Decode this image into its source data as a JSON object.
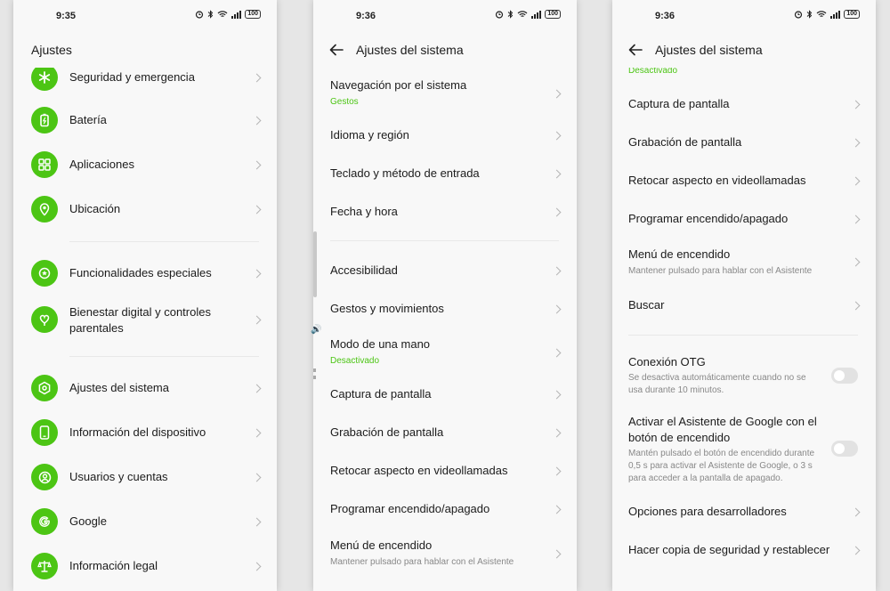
{
  "colors": {
    "accent": "#4cc514",
    "background": "#f8f8f8",
    "text": "#1b1b1b",
    "subtext": "#888888"
  },
  "screen1": {
    "time": "9:35",
    "battery": "100",
    "title": "Ajustes",
    "items": [
      {
        "label": "Seguridad y emergencia",
        "icon": "asterisk-icon"
      },
      {
        "label": "Batería",
        "icon": "battery-icon"
      },
      {
        "label": "Aplicaciones",
        "icon": "apps-grid-icon"
      },
      {
        "label": "Ubicación",
        "icon": "location-pin-icon"
      },
      {
        "label": "Funcionalidades especiales",
        "icon": "star-badge-icon"
      },
      {
        "label": "Bienestar digital y controles parentales",
        "icon": "heart-hand-icon"
      },
      {
        "label": "Ajustes del sistema",
        "icon": "gear-hexagon-icon"
      },
      {
        "label": "Información del dispositivo",
        "icon": "phone-device-icon"
      },
      {
        "label": "Usuarios y cuentas",
        "icon": "user-icon"
      },
      {
        "label": "Google",
        "icon": "google-icon"
      },
      {
        "label": "Información legal",
        "icon": "scales-icon"
      }
    ]
  },
  "screen2": {
    "time": "9:36",
    "battery": "100",
    "title": "Ajustes del sistema",
    "items": [
      {
        "label": "Navegación por el sistema",
        "sub": "Gestos"
      },
      {
        "label": "Idioma y región"
      },
      {
        "label": "Teclado y método de entrada"
      },
      {
        "label": "Fecha y hora"
      },
      {
        "label": "Accesibilidad"
      },
      {
        "label": "Gestos y movimientos"
      },
      {
        "label": "Modo de una mano",
        "sub": "Desactivado"
      },
      {
        "label": "Captura de pantalla"
      },
      {
        "label": "Grabación de pantalla"
      },
      {
        "label": "Retocar aspecto en videollamadas"
      },
      {
        "label": "Programar encendido/apagado"
      },
      {
        "label": "Menú de encendido",
        "sub": "Mantener pulsado para hablar con el Asistente"
      }
    ]
  },
  "screen3": {
    "time": "9:36",
    "battery": "100",
    "title": "Ajustes del sistema",
    "top_sub": "Desactivado",
    "items": [
      {
        "label": "Captura de pantalla"
      },
      {
        "label": "Grabación de pantalla"
      },
      {
        "label": "Retocar aspecto en videollamadas"
      },
      {
        "label": "Programar encendido/apagado"
      },
      {
        "label": "Menú de encendido",
        "sub": "Mantener pulsado para hablar con el Asistente"
      },
      {
        "label": "Buscar"
      },
      {
        "label": "Conexión OTG",
        "sub": "Se desactiva automáticamente cuando no se usa durante 10 minutos.",
        "toggle": false
      },
      {
        "label": "Activar el Asistente de Google con el botón de encendido",
        "sub": "Mantén pulsado el botón de encendido durante 0,5 s para activar el Asistente de Google, o 3 s para acceder a la pantalla de apagado.",
        "toggle": false
      },
      {
        "label": "Opciones para desarrolladores"
      },
      {
        "label": "Hacer copia de seguridad y restablecer"
      }
    ]
  }
}
